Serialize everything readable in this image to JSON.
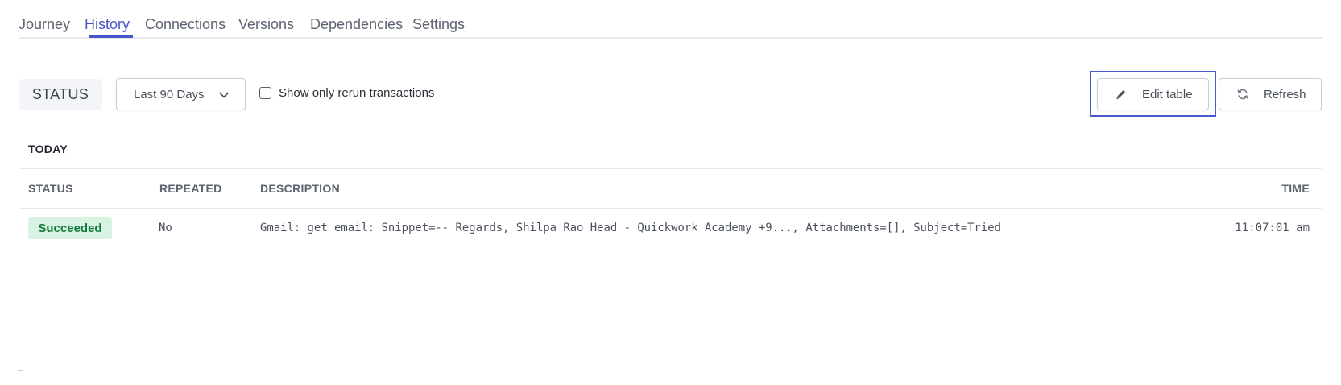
{
  "tabs": [
    {
      "label": "Journey",
      "active": false
    },
    {
      "label": "History",
      "active": true
    },
    {
      "label": "Connections",
      "active": false
    },
    {
      "label": "Versions",
      "active": false
    },
    {
      "label": "Dependencies",
      "active": false
    },
    {
      "label": "Settings",
      "active": false
    }
  ],
  "toolbar": {
    "status_label": "STATUS",
    "date_range": "Last 90 Days",
    "rerun_checkbox_label": "Show only rerun transactions",
    "rerun_checked": false,
    "edit_table_label": "Edit table",
    "refresh_label": "Refresh"
  },
  "group": {
    "label": "TODAY"
  },
  "table": {
    "columns": [
      "STATUS",
      "REPEATED",
      "DESCRIPTION",
      "TIME"
    ],
    "rows": [
      {
        "status": "Succeeded",
        "repeated": "No",
        "description": "Gmail: get email: Snippet=-- Regards, Shilpa Rao Head - Quickwork Academy +9..., Attachments=[], Subject=Tried",
        "time": "11:07:01 am"
      }
    ]
  },
  "colors": {
    "accent": "#4556c8",
    "focus_outline": "#4a5bd0",
    "success_bg": "#d8f3e2",
    "success_text": "#137a3c"
  },
  "icons": {
    "dropdown": "chevron-down-icon",
    "edit": "pencil-icon",
    "refresh": "refresh-icon"
  }
}
